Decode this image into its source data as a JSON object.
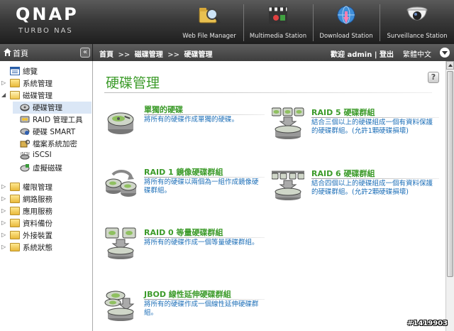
{
  "header": {
    "logo": "QNAP",
    "sublogo": "TURBO NAS",
    "stations": [
      {
        "label": "Web File Manager",
        "icon": "folder-magnifier-icon"
      },
      {
        "label": "Multimedia Station",
        "icon": "film-clapper-icon"
      },
      {
        "label": "Download Station",
        "icon": "download-globe-icon"
      },
      {
        "label": "Surveillance Station",
        "icon": "camera-icon"
      }
    ]
  },
  "subbar": {
    "home": "首頁",
    "collapse": "«",
    "breadcrumb": [
      "首頁",
      "磁碟管理",
      "硬碟管理"
    ],
    "breadcrumb_sep": ">>",
    "welcome": "歡迎 admin | 登出",
    "language": "繁體中文"
  },
  "sidebar": {
    "items": [
      {
        "label": "總覽",
        "icon": "overview-icon"
      },
      {
        "label": "系統管理",
        "icon": "folder-icon"
      },
      {
        "label": "磁碟管理",
        "icon": "folder-open-icon"
      },
      {
        "label": "硬碟管理",
        "icon": "disk-icon"
      },
      {
        "label": "RAID 管理工具",
        "icon": "raid-tool-icon"
      },
      {
        "label": "硬碟 SMART",
        "icon": "smart-icon"
      },
      {
        "label": "檔案系統加密",
        "icon": "encryption-icon"
      },
      {
        "label": "iSCSI",
        "icon": "iscsi-icon"
      },
      {
        "label": "虛擬磁碟",
        "icon": "virtual-disk-icon"
      },
      {
        "label": "權限管理",
        "icon": "folder-icon"
      },
      {
        "label": "網路服務",
        "icon": "folder-icon"
      },
      {
        "label": "應用服務",
        "icon": "folder-icon"
      },
      {
        "label": "資料備份",
        "icon": "folder-icon"
      },
      {
        "label": "外接裝置",
        "icon": "folder-icon"
      },
      {
        "label": "系統狀態",
        "icon": "folder-icon"
      }
    ]
  },
  "main": {
    "title": "硬碟管理",
    "help": "?",
    "options": [
      {
        "title": "單獨的硬碟",
        "desc": "將所有的硬碟作成單獨的硬碟。"
      },
      {
        "title": "RAID 1 鏡像硬碟群組",
        "desc": "將所有的硬碟以兩個為一組作成鏡像硬碟群組。"
      },
      {
        "title": "RAID 0 等量硬碟群組",
        "desc": "將所有的硬碟作成一個等量硬碟群組。"
      },
      {
        "title": "JBOD 線性延伸硬碟群組",
        "desc": "將所有的硬碟作成一個線性延伸硬碟群組。"
      },
      {
        "title": "RAID 5 硬碟群組",
        "desc": "結合三個以上的硬碟組成一個有資料保護的硬碟群組。(允許1顆硬碟損壞)"
      },
      {
        "title": "RAID 6 硬碟群組",
        "desc": "結合四個以上的硬碟組成一個有資料保護的硬碟群組。(允許2顆硬碟損壞)"
      }
    ]
  },
  "watermark": "#1419903",
  "colors": {
    "accent_green": "#3c9b2a",
    "link_blue": "#1d6fb8",
    "header_dark": "#2a2a2a"
  }
}
